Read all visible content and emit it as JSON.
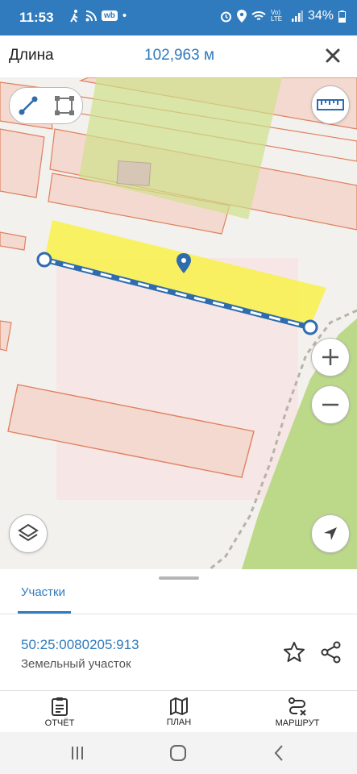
{
  "status_bar": {
    "time": "11:53",
    "battery_percent": "34%",
    "left_icons": [
      "walk-icon",
      "rss-icon",
      "wb-icon",
      "dot-icon"
    ],
    "right_icons": [
      "alarm-icon",
      "location-icon",
      "wifi-icon",
      "volte-label",
      "signal-icon",
      "battery-icon"
    ],
    "volte_label": "Vo) LTE",
    "wb_label": "wb",
    "color": "#2f7bbd"
  },
  "header": {
    "title": "Длина",
    "measure_value": "102,963 м"
  },
  "map": {
    "mode_buttons": [
      "line-measure-icon",
      "area-measure-icon"
    ],
    "ruler_button": "ruler-icon",
    "zoom_in": "zoom-in-icon",
    "zoom_out": "zoom-out-icon",
    "layers_button": "layers-icon",
    "locate_button": "navigate-icon"
  },
  "sheet": {
    "tab_label": "Участки",
    "parcel_number": "50:25:0080205:913",
    "parcel_type": "Земельный участок"
  },
  "bottom_nav": {
    "items": [
      {
        "label": "ОТЧЁТ",
        "icon": "report-icon"
      },
      {
        "label": "ПЛАН",
        "icon": "map-plan-icon"
      },
      {
        "label": "МАРШРУТ",
        "icon": "route-icon"
      }
    ]
  },
  "system_nav": [
    "recents-icon",
    "home-icon",
    "back-icon"
  ],
  "colors": {
    "accent": "#2f7bbd",
    "parcel_fill": "#f3d9cf",
    "parcel_stroke": "#e0805e",
    "highlight": "#f8f05a",
    "green": "#bcd98a"
  }
}
